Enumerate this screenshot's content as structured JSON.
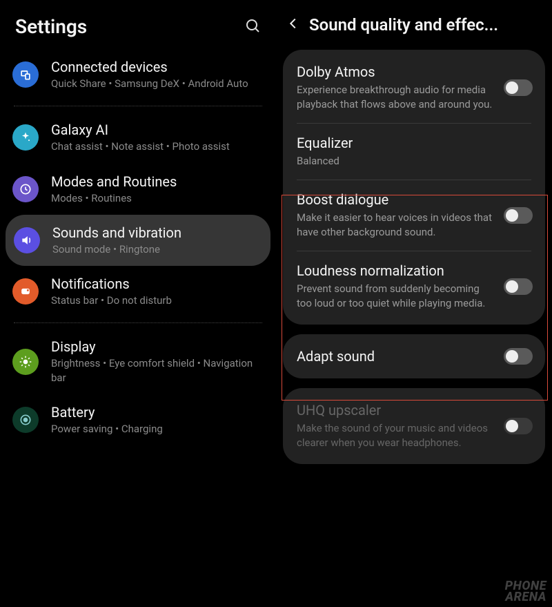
{
  "left": {
    "title": "Settings",
    "items": [
      {
        "title": "Connected devices",
        "sub": "Quick Share  •  Samsung DeX  •  Android Auto"
      },
      {
        "title": "Galaxy AI",
        "sub": "Chat assist  •  Note assist  •  Photo assist"
      },
      {
        "title": "Modes and Routines",
        "sub": "Modes  •  Routines"
      },
      {
        "title": "Sounds and vibration",
        "sub": "Sound mode  •  Ringtone"
      },
      {
        "title": "Notifications",
        "sub": "Status bar  •  Do not disturb"
      },
      {
        "title": "Display",
        "sub": "Brightness  •  Eye comfort shield  •  Navigation bar"
      },
      {
        "title": "Battery",
        "sub": "Power saving  •  Charging"
      }
    ]
  },
  "right": {
    "title": "Sound quality and effec...",
    "card1": {
      "dolby": {
        "title": "Dolby Atmos",
        "desc": "Experience breakthrough audio for media playback that flows above and around you."
      },
      "eq": {
        "title": "Equalizer",
        "desc": "Balanced"
      },
      "boost": {
        "title": "Boost dialogue",
        "desc": "Make it easier to hear voices in videos that have other background sound."
      },
      "loud": {
        "title": "Loudness normalization",
        "desc": "Prevent sound from suddenly becoming too loud or too quiet while playing media."
      }
    },
    "card2": {
      "adapt": {
        "title": "Adapt sound"
      }
    },
    "card3": {
      "uhq": {
        "title": "UHQ upscaler",
        "desc": "Make the sound of your music and videos clearer when you wear headphones."
      }
    }
  },
  "watermark": {
    "line1": "PHONE",
    "line2": "ARENA"
  }
}
